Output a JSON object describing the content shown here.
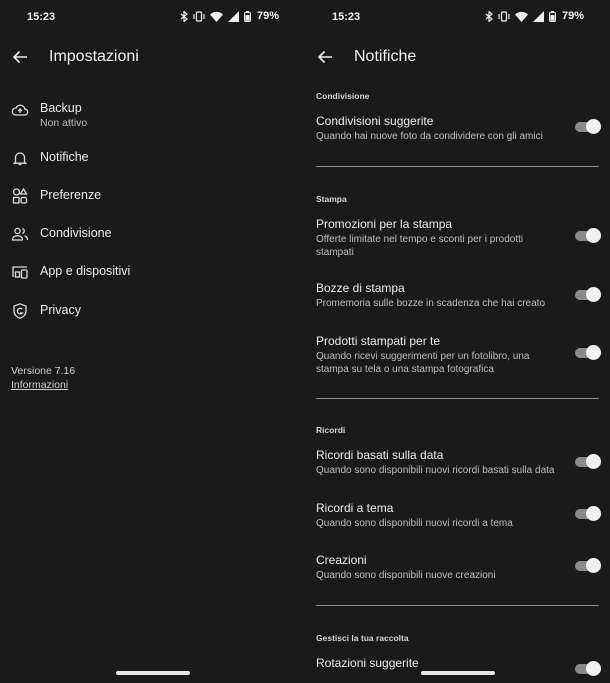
{
  "status_bar": {
    "time": "15:23",
    "battery": "79%"
  },
  "left": {
    "title": "Impostazioni",
    "items": [
      {
        "label": "Backup",
        "sub": "Non attivo",
        "icon": "cloud-upload-icon"
      },
      {
        "label": "Notifiche",
        "icon": "bell-icon"
      },
      {
        "label": "Preferenze",
        "icon": "shapes-icon"
      },
      {
        "label": "Condivisione",
        "icon": "people-icon"
      },
      {
        "label": "App e dispositivi",
        "icon": "devices-icon"
      },
      {
        "label": "Privacy",
        "icon": "shield-icon"
      }
    ],
    "version": "Versione 7.16",
    "info_link": "Informazioni"
  },
  "right": {
    "title": "Notifiche",
    "sections": [
      {
        "header": "Condivisione",
        "items": [
          {
            "title": "Condivisioni suggerite",
            "sub": "Quando hai nuove foto da condividere con gli amici",
            "on": true
          }
        ]
      },
      {
        "header": "Stampa",
        "items": [
          {
            "title": "Promozioni per la stampa",
            "sub": "Offerte limitate nel tempo e sconti per i prodotti stampati",
            "on": true
          },
          {
            "title": "Bozze di stampa",
            "sub": "Promemoria sulle bozze in scadenza che hai creato",
            "on": true
          },
          {
            "title": "Prodotti stampati per te",
            "sub": "Quando ricevi suggerimenti per un fotolibro, una stampa su tela o una stampa fotografica",
            "on": true
          }
        ]
      },
      {
        "header": "Ricordi",
        "items": [
          {
            "title": "Ricordi basati sulla data",
            "sub": "Quando sono disponibili nuovi ricordi basati sulla data",
            "on": true
          },
          {
            "title": "Ricordi a tema",
            "sub": "Quando sono disponibili nuovi ricordi a tema",
            "on": true
          },
          {
            "title": "Creazioni",
            "sub": "Quando sono disponibili nuove creazioni",
            "on": true
          }
        ]
      },
      {
        "header": "Gestisci la tua raccolta",
        "items": [
          {
            "title": "Rotazioni suggerite",
            "on": true
          }
        ]
      }
    ]
  },
  "colors": {
    "background": "#1a1a1a",
    "text": "#ececec",
    "toggle_track": "#8a8a8a",
    "toggle_thumb": "#f1f1f1"
  }
}
